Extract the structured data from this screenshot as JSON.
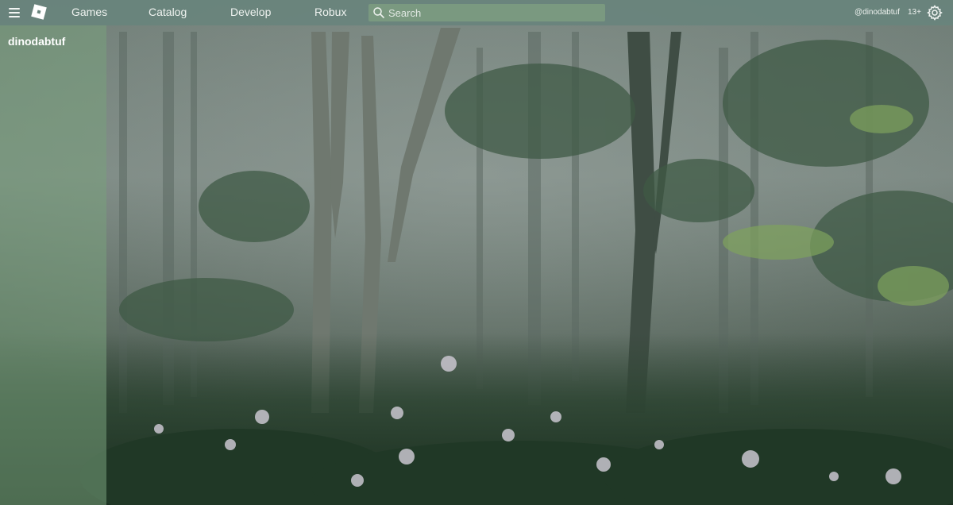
{
  "header": {
    "nav": [
      {
        "label": "Games"
      },
      {
        "label": "Catalog"
      },
      {
        "label": "Develop"
      },
      {
        "label": "Robux"
      }
    ],
    "search": {
      "placeholder": "Search",
      "value": ""
    },
    "username": "@dinodabtuf",
    "age_badge": "13+",
    "icons": {
      "menu": "hamburger-menu-icon",
      "logo": "roblox-logo",
      "search": "search-icon",
      "settings": "gear-icon"
    }
  },
  "sidebar": {
    "username": "dinodabtuf"
  },
  "colors": {
    "topbar": "#68847c",
    "sidebar": "#78a07c",
    "search_field": "#7c9c80",
    "text": "#eef2ef"
  }
}
